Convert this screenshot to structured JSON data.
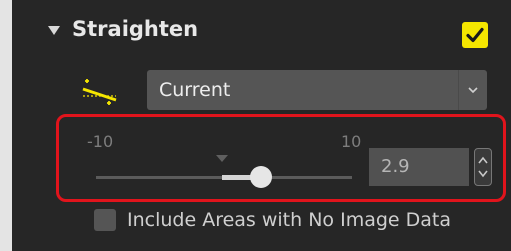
{
  "panel": {
    "title": "Straighten",
    "expanded": true,
    "enabled": true,
    "accent_color": "#f5e600"
  },
  "mode": {
    "icon": "straighten-tool-icon",
    "selected": "Current"
  },
  "slider": {
    "min_label": "-10",
    "max_label": "10",
    "min": -10,
    "max": 10,
    "value": 2.9,
    "value_text": "2.9"
  },
  "options": {
    "include_no_data_label": "Include Areas with No Image Data",
    "include_no_data_checked": false
  },
  "highlight_color": "#e1141c"
}
